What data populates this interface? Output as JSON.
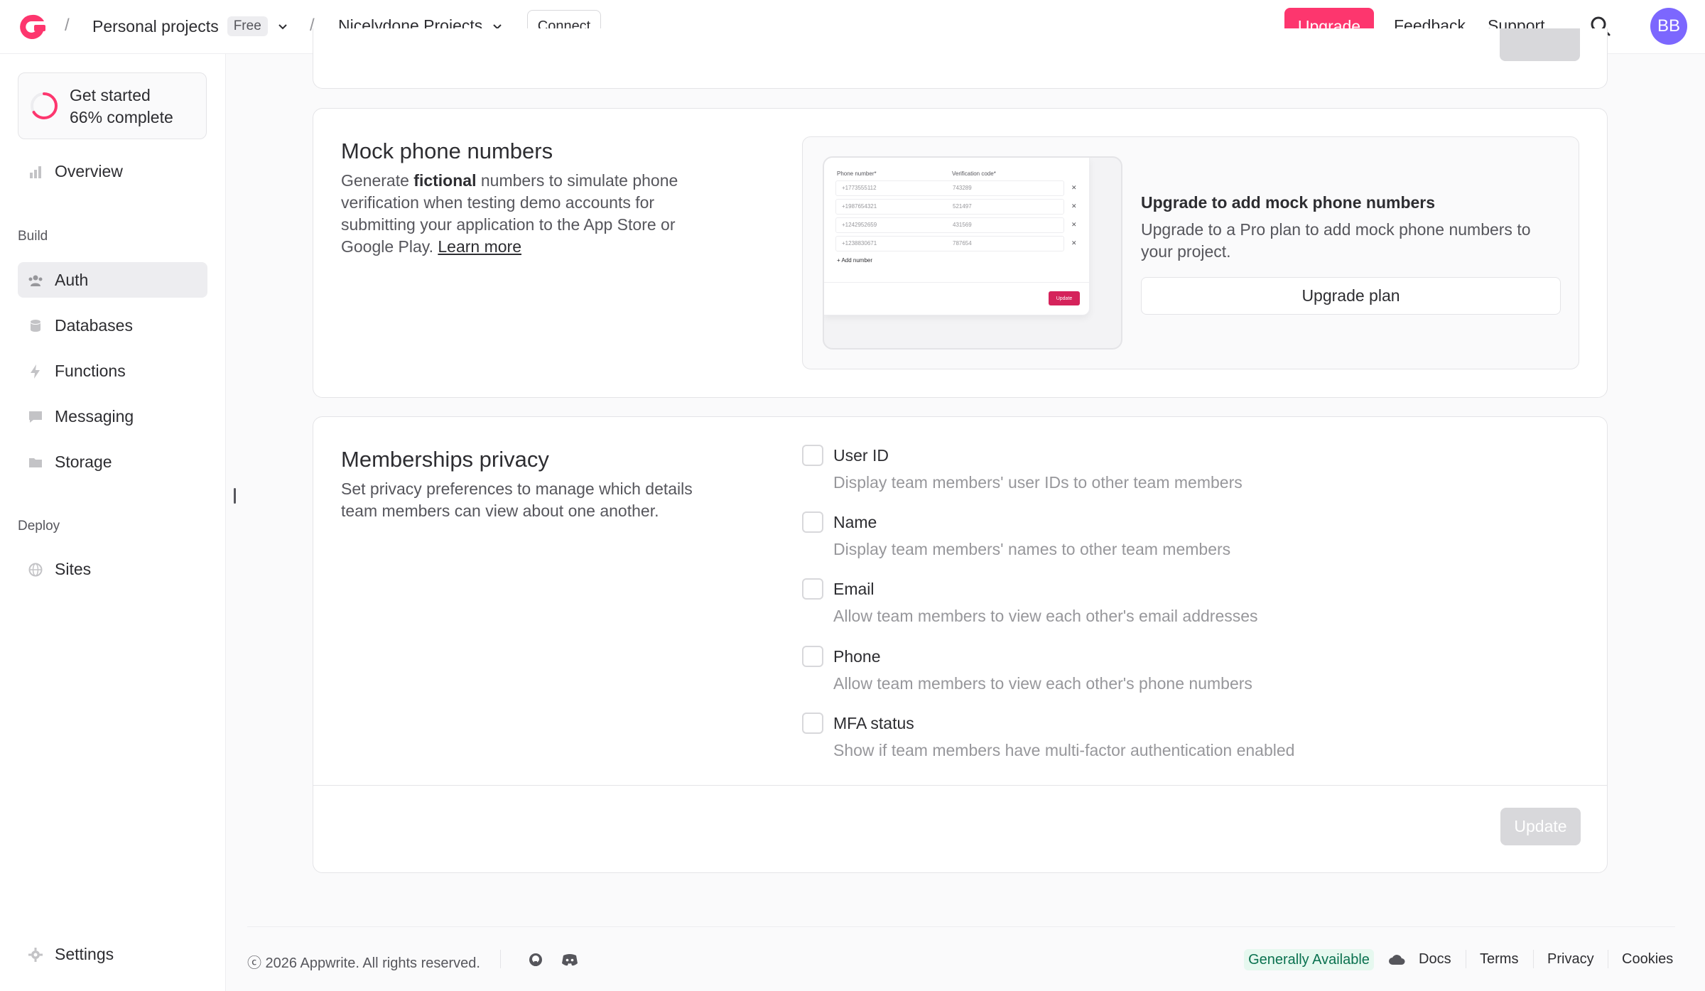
{
  "header": {
    "breadcrumb": {
      "org": "Personal projects",
      "plan_badge": "Free",
      "project": "Nicelydone Projects"
    },
    "connect_label": "Connect",
    "upgrade_label": "Upgrade",
    "feedback_label": "Feedback",
    "support_label": "Support",
    "avatar_initials": "BB"
  },
  "sidebar": {
    "get_started": {
      "title": "Get started",
      "progress_text": "66% complete",
      "progress": 0.66
    },
    "overview": "Overview",
    "build_heading": "Build",
    "build_items": [
      "Auth",
      "Databases",
      "Functions",
      "Messaging",
      "Storage"
    ],
    "active_item": "Auth",
    "deploy_heading": "Deploy",
    "deploy_items": [
      "Sites"
    ],
    "settings": "Settings"
  },
  "mock_phone": {
    "title": "Mock phone numbers",
    "desc_before": "Generate ",
    "desc_bold": "fictional",
    "desc_after": " numbers to simulate phone verification when testing demo accounts for submitting your application to the App Store or Google Play. ",
    "learn_more": "Learn more",
    "preview": {
      "col_phone": "Phone number*",
      "col_code": "Verification code*",
      "rows": [
        {
          "phone": "+1773555112",
          "code": "743289"
        },
        {
          "phone": "+1987654321",
          "code": "521497"
        },
        {
          "phone": "+1242952659",
          "code": "431569"
        },
        {
          "phone": "+1238830671",
          "code": "787654"
        }
      ],
      "add_label": "+ Add number",
      "update_label": "Update"
    },
    "upgrade_title": "Upgrade to add mock phone numbers",
    "upgrade_desc": "Upgrade to a Pro plan to add mock phone numbers to your project.",
    "upgrade_plan_label": "Upgrade plan"
  },
  "memberships": {
    "title": "Memberships privacy",
    "desc": "Set privacy preferences to manage which details team members can view about one another.",
    "options": [
      {
        "label": "User ID",
        "desc": "Display team members' user IDs to other team members",
        "checked": false
      },
      {
        "label": "Name",
        "desc": "Display team members' names to other team members",
        "checked": false
      },
      {
        "label": "Email",
        "desc": "Allow team members to view each other's email addresses",
        "checked": false
      },
      {
        "label": "Phone",
        "desc": "Allow team members to view each other's phone numbers",
        "checked": false
      },
      {
        "label": "MFA status",
        "desc": "Show if team members have multi-factor authentication enabled",
        "checked": false
      }
    ],
    "update_label": "Update"
  },
  "footer": {
    "copyright": "ⓒ 2026 Appwrite. All rights reserved.",
    "status_badge": "Generally Available",
    "links": [
      "Docs",
      "Terms",
      "Privacy",
      "Cookies"
    ]
  },
  "colors": {
    "brand": "#fd366e",
    "avatar": "#7c67fe",
    "status_green_bg": "#e6f8ef",
    "status_green_text": "#0a714f"
  }
}
